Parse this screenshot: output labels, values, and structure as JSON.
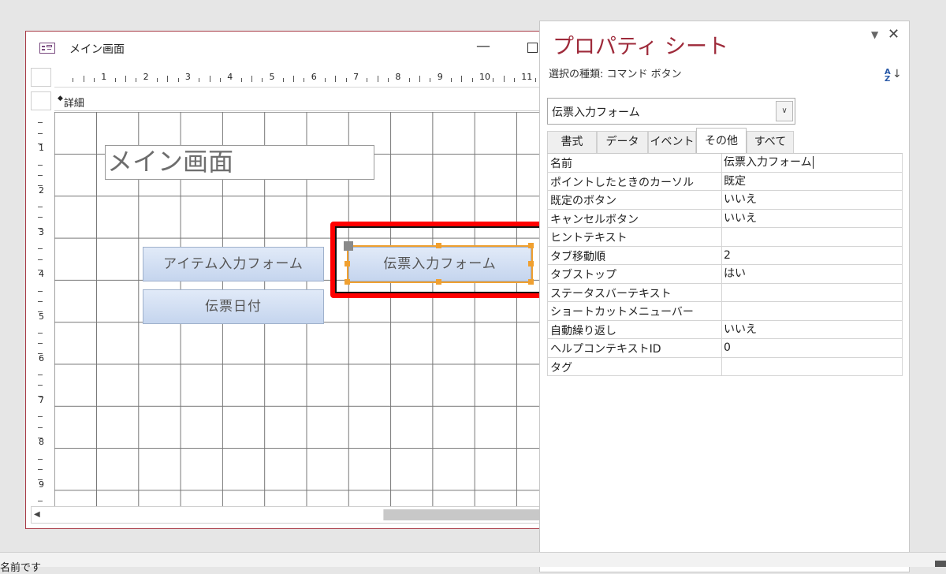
{
  "form_window": {
    "title": "メイン画面",
    "minimize_glyph": "—",
    "section_label": "詳細",
    "ruler_numbers": [
      "1",
      "2",
      "3",
      "4",
      "5",
      "6",
      "7",
      "8",
      "9",
      "10",
      "11"
    ],
    "vruler_numbers": [
      "1",
      "2",
      "3",
      "4",
      "5",
      "6",
      "7",
      "8",
      "9"
    ],
    "title_label_text": "メイン画面",
    "buttons": {
      "item_entry": "アイテム入力フォーム",
      "slip_date": "伝票日付",
      "slip_entry": "伝票入力フォーム"
    }
  },
  "property_sheet": {
    "title": "プロパティ シート",
    "selection_type": "選択の種類: コマンド ボタン",
    "close_glyph": "✕",
    "dropdown_glyph": "▼",
    "sort_glyph_top": "A",
    "sort_glyph_bottom": "Z",
    "sort_arrow": "↓",
    "combo_value": "伝票入力フォーム",
    "combo_arrow": "∨",
    "tabs": [
      "書式",
      "データ",
      "イベント",
      "その他",
      "すべて"
    ],
    "active_tab": "その他",
    "rows": [
      {
        "key": "名前",
        "value": "伝票入力フォーム"
      },
      {
        "key": "ポイントしたときのカーソル",
        "value": "既定"
      },
      {
        "key": "既定のボタン",
        "value": "いいえ"
      },
      {
        "key": "キャンセルボタン",
        "value": "いいえ"
      },
      {
        "key": "ヒントテキスト",
        "value": ""
      },
      {
        "key": "タブ移動順",
        "value": "2"
      },
      {
        "key": "タブストップ",
        "value": "はい"
      },
      {
        "key": "ステータスバーテキスト",
        "value": ""
      },
      {
        "key": "ショートカットメニューバー",
        "value": ""
      },
      {
        "key": "自動繰り返し",
        "value": "いいえ"
      },
      {
        "key": "ヘルプコンテキストID",
        "value": "0"
      },
      {
        "key": "タグ",
        "value": ""
      }
    ]
  },
  "statusbar": {
    "text": "名前です"
  },
  "colors": {
    "title_red": "#9e2a3a",
    "highlight": "#ff0000",
    "selection": "#f0a030",
    "window_border": "#a83a46"
  }
}
